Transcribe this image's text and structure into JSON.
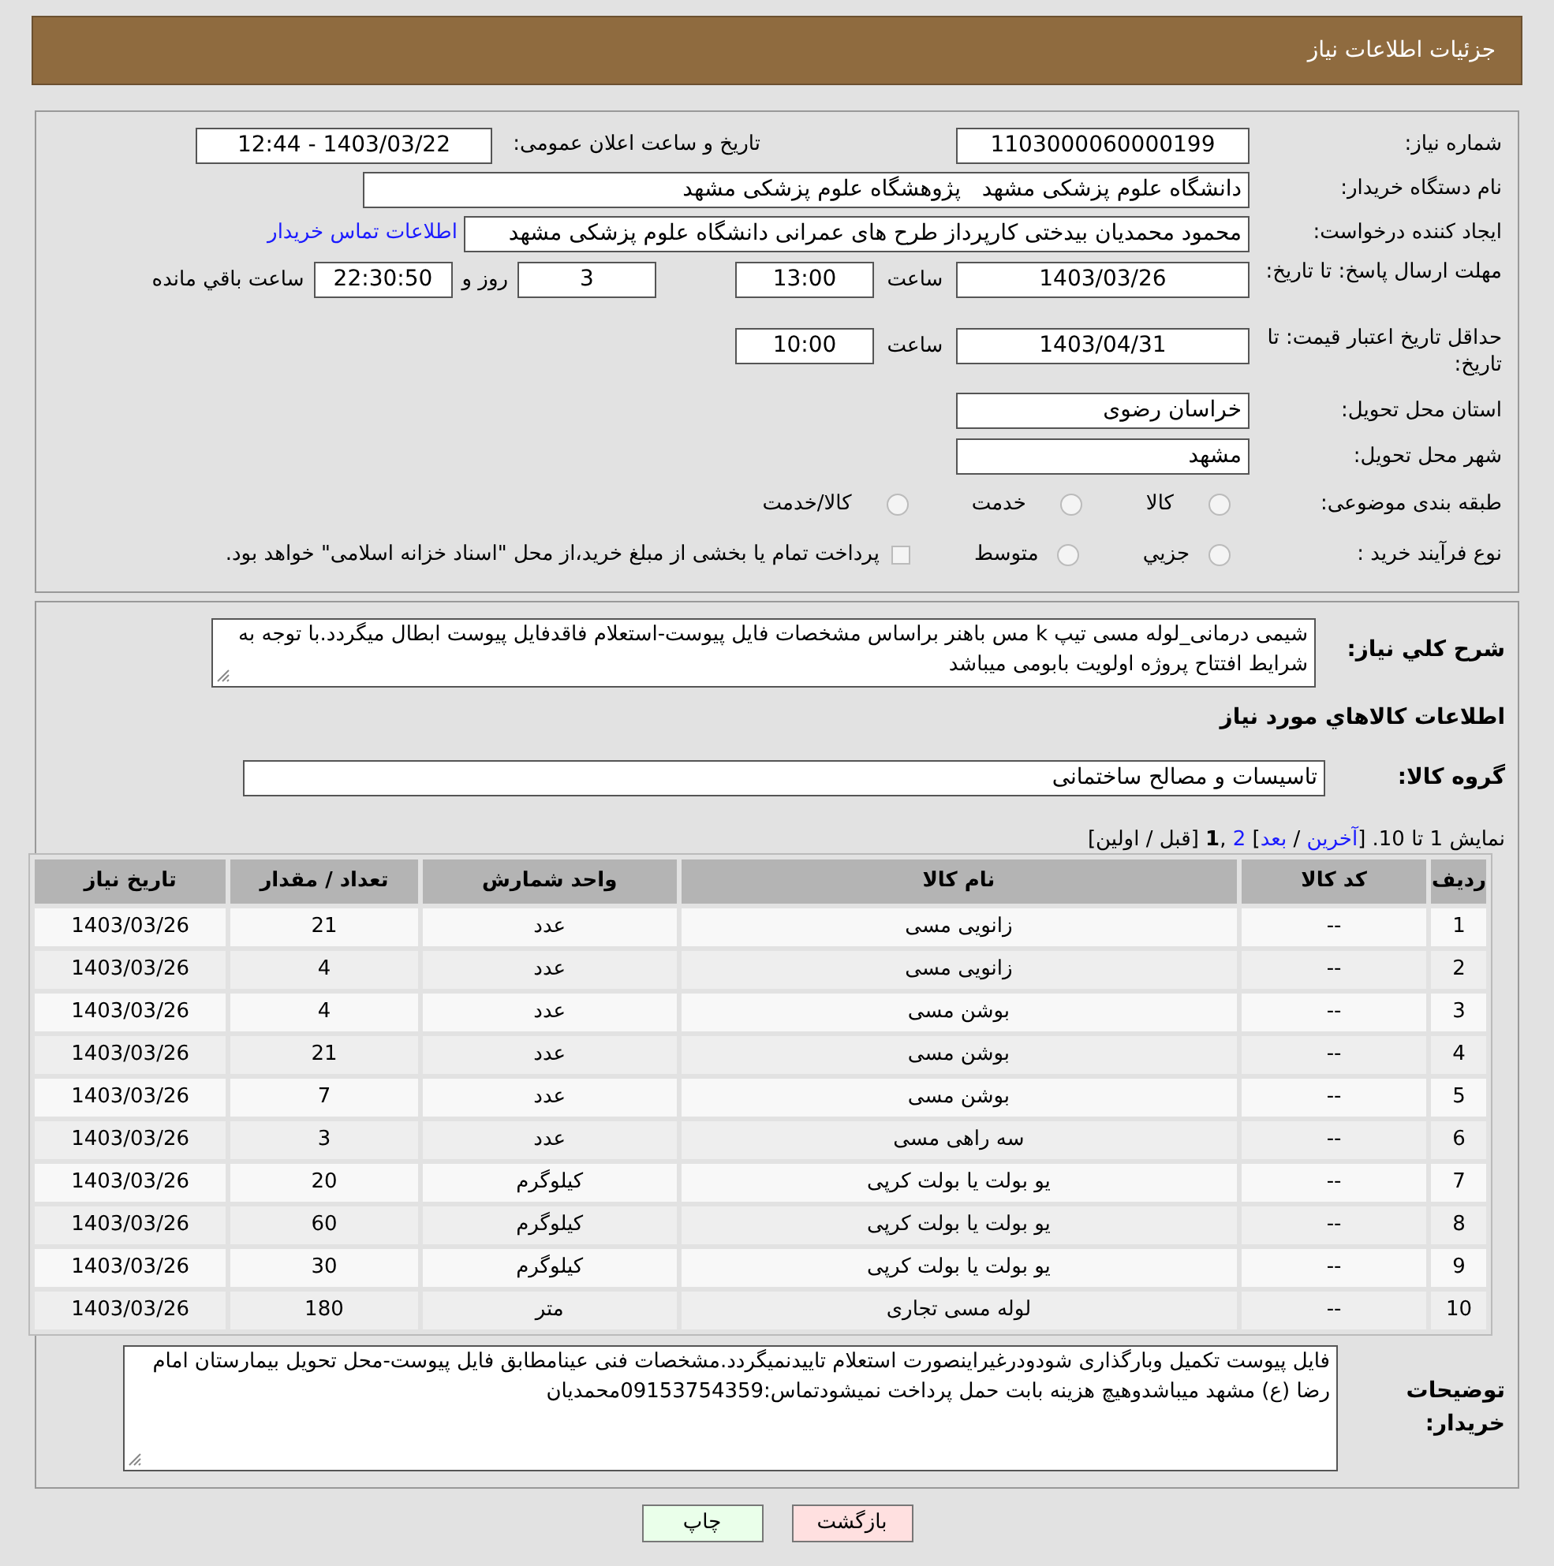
{
  "header": {
    "title": "جزئیات اطلاعات نیاز"
  },
  "need_number": {
    "label": "شماره نیاز:",
    "value": "1103000060000199"
  },
  "announce": {
    "label": "تاریخ و ساعت اعلان عمومی:",
    "value": "1403/03/22 - 12:44"
  },
  "buyer_org": {
    "label": "نام دستگاه خریدار:",
    "value": "دانشگاه علوم پزشکی مشهد   پژوهشگاه علوم پزشکی مشهد"
  },
  "requester": {
    "label": "ایجاد کننده درخواست:",
    "value": "محمود محمدیان بیدختی کارپرداز طرح های عمرانی دانشگاه علوم پزشکی مشهد",
    "link": "اطلاعات تماس خریدار"
  },
  "deadline": {
    "label": "مهلت ارسال پاسخ: تا تاریخ:",
    "date": "1403/03/26",
    "time_label": "ساعت",
    "time": "13:00",
    "days": "3",
    "days_label": "روز و",
    "remaining": "22:30:50",
    "remaining_label": "ساعت باقي مانده"
  },
  "validity": {
    "label": "حداقل تاریخ اعتبار قیمت: تا تاریخ:",
    "date": "1403/04/31",
    "time_label": "ساعت",
    "time": "10:00"
  },
  "province": {
    "label": "استان محل تحویل:",
    "value": "خراسان رضوی"
  },
  "city": {
    "label": "شهر محل تحویل:",
    "value": "مشهد"
  },
  "category": {
    "label": "طبقه بندی موضوعی:",
    "options": [
      {
        "label": "کالا",
        "selected": false
      },
      {
        "label": "خدمت",
        "selected": false
      },
      {
        "label": "کالا/خدمت",
        "selected": false
      }
    ]
  },
  "purchase_type": {
    "label": "نوع فرآیند خرید :",
    "options": [
      {
        "label": "جزيي",
        "selected": false
      },
      {
        "label": "متوسط",
        "selected": false
      }
    ],
    "treasury": {
      "label": "پرداخت تمام یا بخشی از مبلغ خرید،از محل \"اسناد خزانه اسلامی\" خواهد بود.",
      "checked": false
    }
  },
  "description": {
    "label": "شرح کلي نياز:",
    "value": "شیمی درمانی_لوله مسی تیپ k مس باهنر براساس مشخصات فایل پیوست-استعلام فاقدفایل پیوست ابطال میگردد.با توجه به شرایط افتتاح پروژه اولویت بابومی میباشد"
  },
  "goods_title": "اطلاعات کالاهاي مورد نياز",
  "goods_group": {
    "label": "گروه کالا:",
    "value": "تاسیسات و مصالح ساختمانی"
  },
  "pagination": [
    {
      "kind": "text",
      "text": "نمایش 1 تا 10. ["
    },
    {
      "kind": "link",
      "text": "آخرین"
    },
    {
      "kind": "text",
      "text": " / "
    },
    {
      "kind": "link",
      "text": "بعد"
    },
    {
      "kind": "text",
      "text": "] "
    },
    {
      "kind": "link",
      "text": "2"
    },
    {
      "kind": "text",
      "text": " ,"
    },
    {
      "kind": "current",
      "text": "1"
    },
    {
      "kind": "text",
      "text": " [قبل / اولین]"
    }
  ],
  "table": {
    "columns": [
      "ردیف",
      "کد کالا",
      "نام کالا",
      "واحد شمارش",
      "تعداد / مقدار",
      "تاریخ نیاز"
    ],
    "rows": [
      [
        "1",
        "--",
        "زانویی مسی",
        "عدد",
        "21",
        "1403/03/26"
      ],
      [
        "2",
        "--",
        "زانویی مسی",
        "عدد",
        "4",
        "1403/03/26"
      ],
      [
        "3",
        "--",
        "بوشن مسی",
        "عدد",
        "4",
        "1403/03/26"
      ],
      [
        "4",
        "--",
        "بوشن مسی",
        "عدد",
        "21",
        "1403/03/26"
      ],
      [
        "5",
        "--",
        "بوشن مسی",
        "عدد",
        "7",
        "1403/03/26"
      ],
      [
        "6",
        "--",
        "سه راهی مسی",
        "عدد",
        "3",
        "1403/03/26"
      ],
      [
        "7",
        "--",
        "یو بولت یا بولت کرپی",
        "کیلوگرم",
        "20",
        "1403/03/26"
      ],
      [
        "8",
        "--",
        "یو بولت یا بولت کرپی",
        "کیلوگرم",
        "60",
        "1403/03/26"
      ],
      [
        "9",
        "--",
        "یو بولت یا بولت کرپی",
        "کیلوگرم",
        "30",
        "1403/03/26"
      ],
      [
        "10",
        "--",
        "لوله مسی تجاری",
        "متر",
        "180",
        "1403/03/26"
      ]
    ]
  },
  "notes": {
    "label": "توضیحات خریدار:",
    "value": "فایل پیوست تکمیل وبارگذاری شودودرغیراینصورت استعلام تاییدنمیگردد.مشخصات فنی عینامطابق فایل پیوست-محل تحویل بیمارستان امام رضا (ع) مشهد میباشدوهیچ هزینه بابت حمل پرداخت نمیشودتماس:09153754359محمدیان"
  },
  "buttons": [
    {
      "kind": "back",
      "label": "بازگشت"
    },
    {
      "kind": "print",
      "label": "چاپ"
    }
  ]
}
